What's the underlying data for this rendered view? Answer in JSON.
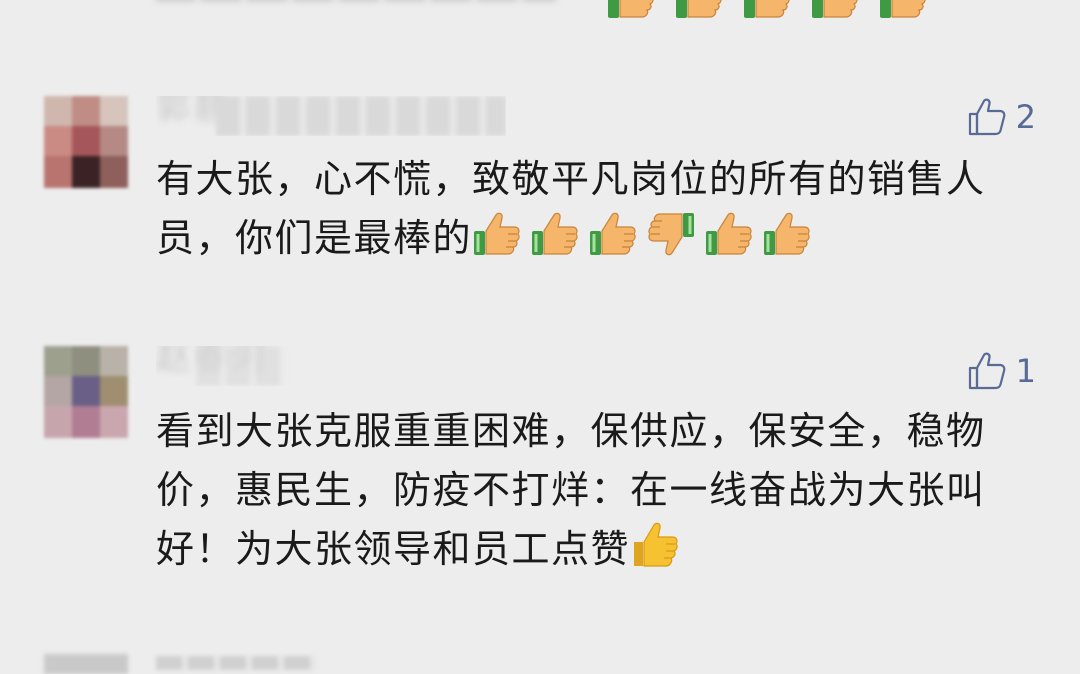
{
  "comments": [
    {
      "name": "郭静",
      "likes": "2",
      "text": "有大张，心不慌，致敬平凡岗位的所有的销售人员，你们是最棒的",
      "emojis": [
        "thumbs-up-icon",
        "thumbs-up-icon",
        "thumbs-up-icon",
        "thumbs-down-icon",
        "thumbs-up-icon",
        "thumbs-up-icon"
      ]
    },
    {
      "name": "赵春河",
      "likes": "1",
      "text": "看到大张克服重重困难，保供应，保安全，稳物价，惠民生，防疫不打烊：在一线奋战为大张叫好！为大张领导和员工点赞",
      "emojis": [
        "thumbs-up-yellow-icon"
      ]
    }
  ],
  "colors": {
    "background": "#ededed",
    "like_accent": "#576b95",
    "text": "#1a1a1a",
    "emoji_skin": "#f5b56a",
    "emoji_cuff": "#3f9b43",
    "emoji_yellow": "#f7c232"
  }
}
